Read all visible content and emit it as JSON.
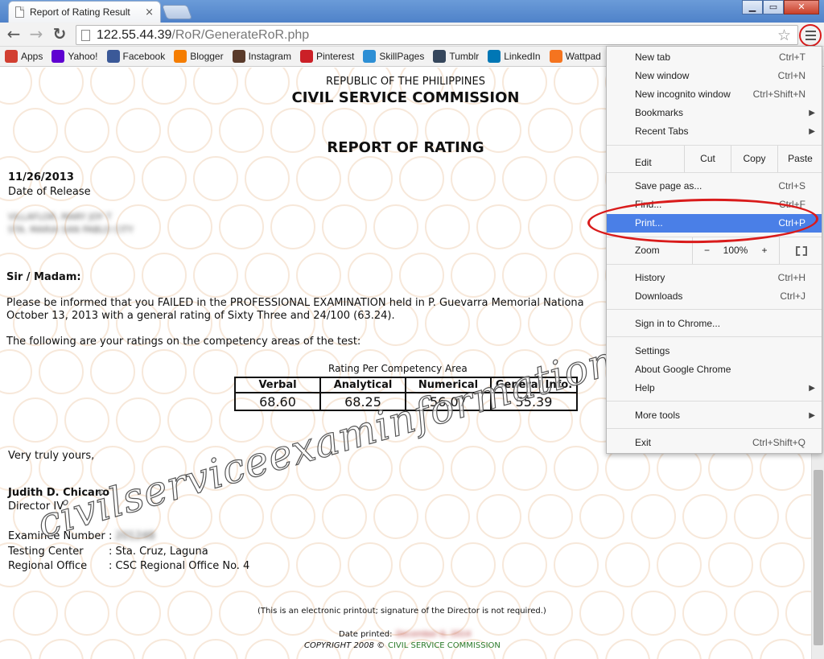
{
  "tab": {
    "title": "Report of Rating Result",
    "close": "×"
  },
  "window": {
    "minimize": "▁",
    "maximize": "▭",
    "close": "✕"
  },
  "toolbar": {
    "back": "←",
    "forward": "→",
    "reload": "↻",
    "url_host": "122.55.44.39",
    "url_path": "/RoR/GenerateRoR.php",
    "star": "☆"
  },
  "bookmarks": [
    {
      "label": "Apps",
      "icon": "apps-icon",
      "color": "#d23f31"
    },
    {
      "label": "Yahoo!",
      "icon": "yahoo-icon",
      "color": "#5f01d1"
    },
    {
      "label": "Facebook",
      "icon": "facebook-icon",
      "color": "#3b5998"
    },
    {
      "label": "Blogger",
      "icon": "blogger-icon",
      "color": "#f57d00"
    },
    {
      "label": "Instagram",
      "icon": "instagram-icon",
      "color": "#5a3b2b"
    },
    {
      "label": "Pinterest",
      "icon": "pinterest-icon",
      "color": "#cb2027"
    },
    {
      "label": "SkillPages",
      "icon": "skillpages-icon",
      "color": "#2d8fd5"
    },
    {
      "label": "Tumblr",
      "icon": "tumblr-icon",
      "color": "#35465c"
    },
    {
      "label": "LinkedIn",
      "icon": "linkedin-icon",
      "color": "#0077b5"
    },
    {
      "label": "Wattpad",
      "icon": "wattpad-icon",
      "color": "#f5741f"
    }
  ],
  "report": {
    "header1": "REPUBLIC OF THE PHILIPPINES",
    "header2": "CIVIL SERVICE COMMISSION",
    "heading": "REPORT OF RATING",
    "date": "11/26/2013",
    "date_label": "Date of Release",
    "blurred_name": "VILLAFLOR, MARY JOY T",
    "blurred_address": "STA. MARIA SAN PABLO CITY",
    "salutation": "Sir / Madam:",
    "para1_line1": "Please be informed that you FAILED in the PROFESSIONAL EXAMINATION held in P. Guevarra Memorial Nationa",
    "para1_line2": "October 13, 2013 with a general rating of Sixty Three and 24/100 (63.24).",
    "para2": "The following are your ratings on the competency areas of the test:",
    "table_caption": "Rating Per Competency Area",
    "columns": [
      "Verbal",
      "Analytical",
      "Numerical",
      "General Info."
    ],
    "values": [
      "68.60",
      "68.25",
      "56.07",
      "55.39"
    ],
    "closing": "Very truly yours,",
    "signatory": "Judith D. Chicano",
    "signatory_title": "Director IV",
    "examinee_label": "Examinee Number",
    "examinee_value": "201248",
    "center_label": "Testing Center",
    "center_value": ": Sta. Cruz, Laguna",
    "office_label": "Regional Office",
    "office_value": ": CSC Regional Office No. 4",
    "note": "(This is an electronic printout; signature of the Director is not required.)",
    "date_printed_label": "Date printed:",
    "date_printed_value": "December 6, 2014",
    "copyright": "COPYRIGHT 2008 ©",
    "copyright_org": "CIVIL SERVICE COMMISSION",
    "watermark": "civilserviceexaminformation.blogspot.com"
  },
  "menu": {
    "new_tab": {
      "label": "New tab",
      "shortcut": "Ctrl+T"
    },
    "new_window": {
      "label": "New window",
      "shortcut": "Ctrl+N"
    },
    "incognito": {
      "label": "New incognito window",
      "shortcut": "Ctrl+Shift+N"
    },
    "bookmarks": {
      "label": "Bookmarks"
    },
    "recent_tabs": {
      "label": "Recent Tabs"
    },
    "edit": {
      "label": "Edit",
      "cut": "Cut",
      "copy": "Copy",
      "paste": "Paste"
    },
    "save_page": {
      "label": "Save page as...",
      "shortcut": "Ctrl+S"
    },
    "find": {
      "label": "Find...",
      "shortcut": "Ctrl+F"
    },
    "print": {
      "label": "Print...",
      "shortcut": "Ctrl+P"
    },
    "zoom": {
      "label": "Zoom",
      "minus": "−",
      "value": "100%",
      "plus": "+"
    },
    "history": {
      "label": "History",
      "shortcut": "Ctrl+H"
    },
    "downloads": {
      "label": "Downloads",
      "shortcut": "Ctrl+J"
    },
    "sign_in": {
      "label": "Sign in to Chrome..."
    },
    "settings": {
      "label": "Settings"
    },
    "about": {
      "label": "About Google Chrome"
    },
    "help": {
      "label": "Help"
    },
    "more_tools": {
      "label": "More tools"
    },
    "exit": {
      "label": "Exit",
      "shortcut": "Ctrl+Shift+Q"
    },
    "arrow": "▶"
  }
}
